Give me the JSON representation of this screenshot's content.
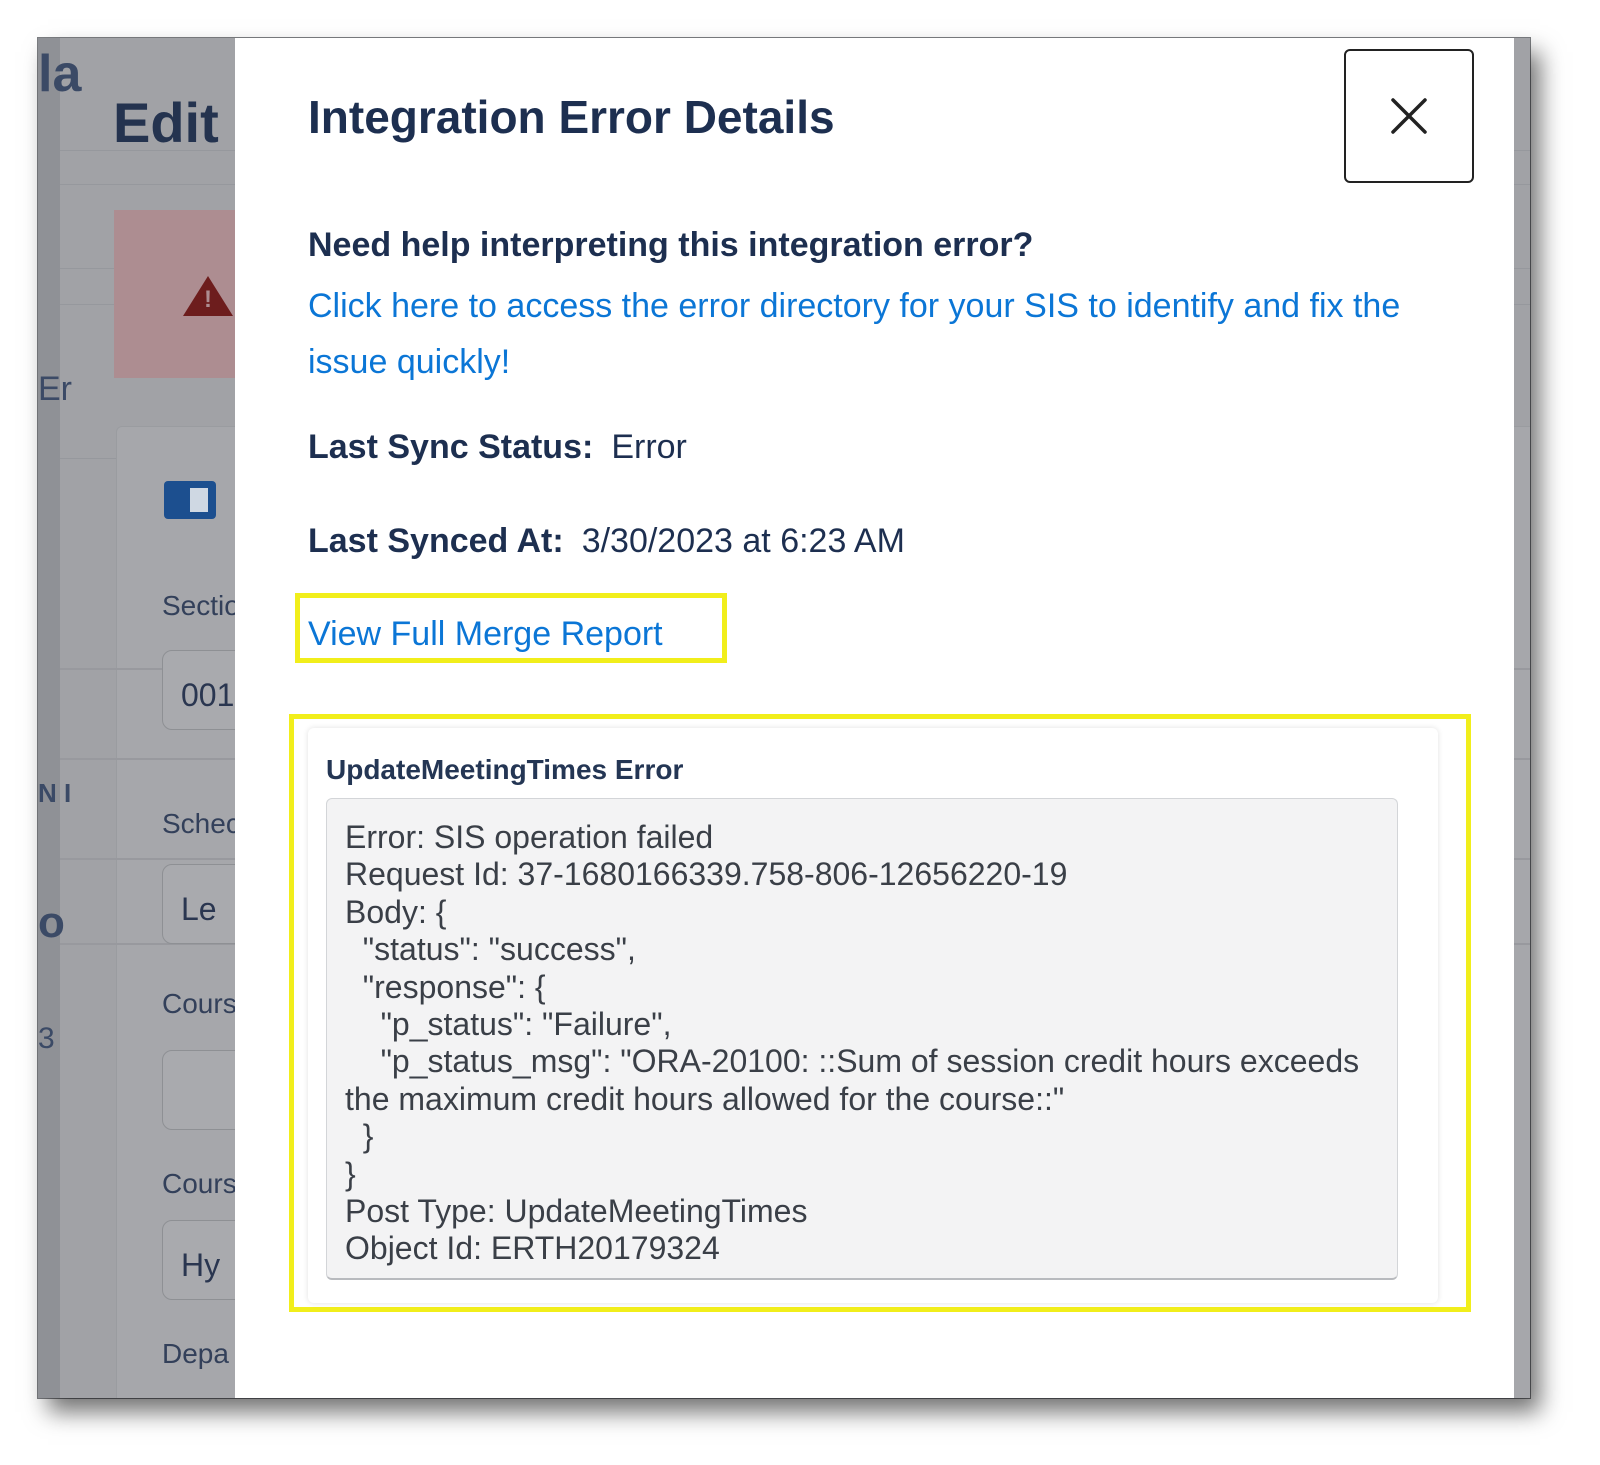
{
  "background": {
    "page_title_fragment": "Edit",
    "left_strip_fragments": [
      "la",
      "Er",
      "N I",
      "o",
      "3"
    ],
    "field_labels": [
      "Sectio",
      "Schec",
      "Cours",
      "Cours",
      "Depa"
    ],
    "field_values": [
      "001",
      "Le",
      "",
      "Hy"
    ]
  },
  "modal": {
    "title": "Integration Error Details",
    "close_icon": "close-icon",
    "help_question": "Need help interpreting this integration error?",
    "help_link": "Click here to access the error directory for your SIS to identify and fix the issue quickly!",
    "last_sync_status_label": "Last Sync Status:",
    "last_sync_status_value": "Error",
    "last_synced_at_label": "Last Synced At:",
    "last_synced_at_value": "3/30/2023 at 6:23 AM",
    "merge_report_link": "View Full Merge Report",
    "error_card_title": "UpdateMeetingTimes Error",
    "error_details": "Error: SIS operation failed\nRequest Id: 37-1680166339.758-806-12656220-19\nBody: {\n  \"status\": \"success\",\n  \"response\": {\n    \"p_status\": \"Failure\",\n    \"p_status_msg\": \"ORA-20100: ::Sum of session credit hours exceeds the maximum credit hours allowed for the course::\"\n  }\n}\nPost Type: UpdateMeetingTimes\nObject Id: ERTH20179324"
  },
  "colors": {
    "highlight": "#f1ee1b",
    "link": "#0b76d6",
    "heading": "#1d2f50"
  }
}
